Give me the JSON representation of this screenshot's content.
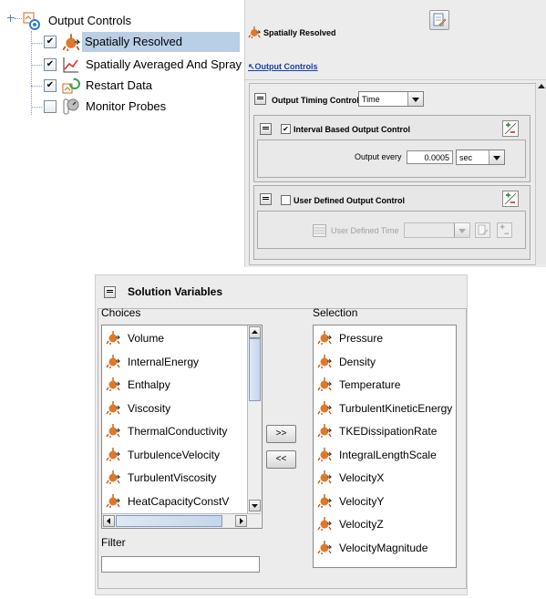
{
  "tree": {
    "root_label": "Output Controls",
    "items": [
      {
        "label": "Spatially Resolved",
        "checked": true,
        "selected": true,
        "icon": "spatially-resolved-icon"
      },
      {
        "label": "Spatially Averaged And Spray",
        "checked": true,
        "selected": false,
        "icon": "line-chart-icon"
      },
      {
        "label": "Restart Data",
        "checked": true,
        "selected": false,
        "icon": "restart-icon"
      },
      {
        "label": "Monitor Probes",
        "checked": false,
        "selected": false,
        "icon": "probe-icon"
      }
    ]
  },
  "panel": {
    "title": "Spatially Resolved",
    "breadcrumb_link": "Output Controls",
    "timing": {
      "label": "Output Timing Control",
      "value": "Time"
    },
    "interval": {
      "label": "Interval Based Output Control",
      "checked": true,
      "output_every_label": "Output every",
      "output_every_value": "0.0005",
      "unit": "sec"
    },
    "user_defined": {
      "label": "User Defined Output Control",
      "checked": false,
      "time_label": "User Defined Time"
    }
  },
  "solution_variables": {
    "title": "Solution Variables",
    "choices_label": "Choices",
    "selection_label": "Selection",
    "filter_label": "Filter",
    "add_label": ">>",
    "remove_label": "<<",
    "choices": [
      "Volume",
      "InternalEnergy",
      "Enthalpy",
      "Viscosity",
      "ThermalConductivity",
      "TurbulenceVelocity",
      "TurbulentViscosity",
      "HeatCapacityConstV"
    ],
    "selection": [
      "Pressure",
      "Density",
      "Temperature",
      "TurbulentKineticEnergy",
      "TKEDissipationRate",
      "IntegralLengthScale",
      "VelocityX",
      "VelocityY",
      "VelocityZ",
      "VelocityMagnitude"
    ]
  },
  "colors": {
    "selected_row": "#b8cfe5",
    "link": "#1a3fa8",
    "panel_bg": "#ececec"
  }
}
